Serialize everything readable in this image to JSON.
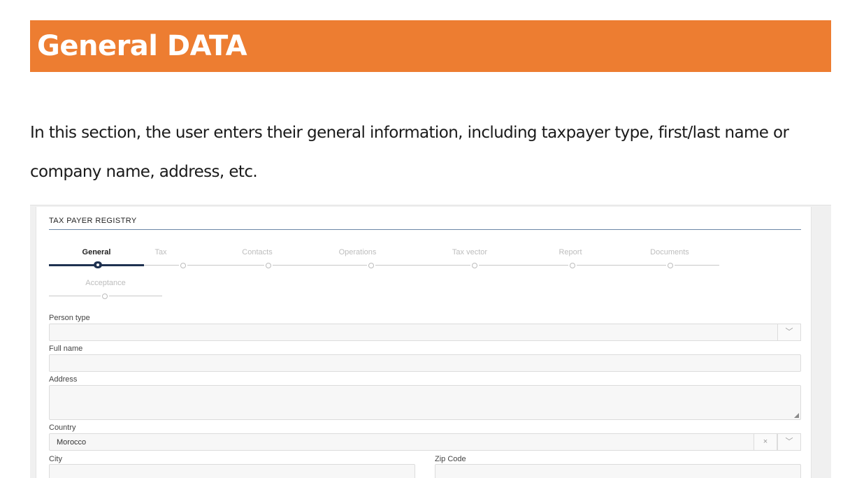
{
  "doc": {
    "heading": "General DATA",
    "intro": "In this section, the user enters their general information, including taxpayer type, first/last name or company name, address, etc."
  },
  "form": {
    "title": "TAX PAYER REGISTRY",
    "steps": [
      {
        "label": "General",
        "active": true
      },
      {
        "label": "Tax",
        "active": false
      },
      {
        "label": "Contacts",
        "active": false
      },
      {
        "label": "Operations",
        "active": false
      },
      {
        "label": "Tax vector",
        "active": false
      },
      {
        "label": "Report",
        "active": false
      },
      {
        "label": "Documents",
        "active": false
      },
      {
        "label": "Acceptance",
        "active": false
      }
    ],
    "fields": {
      "person_type": {
        "label": "Person type",
        "value": ""
      },
      "full_name": {
        "label": "Full name",
        "value": ""
      },
      "address": {
        "label": "Address",
        "value": ""
      },
      "country": {
        "label": "Country",
        "value": "Morocco"
      },
      "city": {
        "label": "City",
        "value": ""
      },
      "zip_code": {
        "label": "Zip Code",
        "value": ""
      }
    },
    "icons": {
      "chevron": "chevron-down-icon",
      "clear": "close-icon"
    },
    "glyphs": {
      "chevron": "﹀",
      "clear": "×"
    }
  },
  "colors": {
    "banner": "#ED7D31",
    "active_step": "#1e3150",
    "rule": "#6b86a6"
  }
}
